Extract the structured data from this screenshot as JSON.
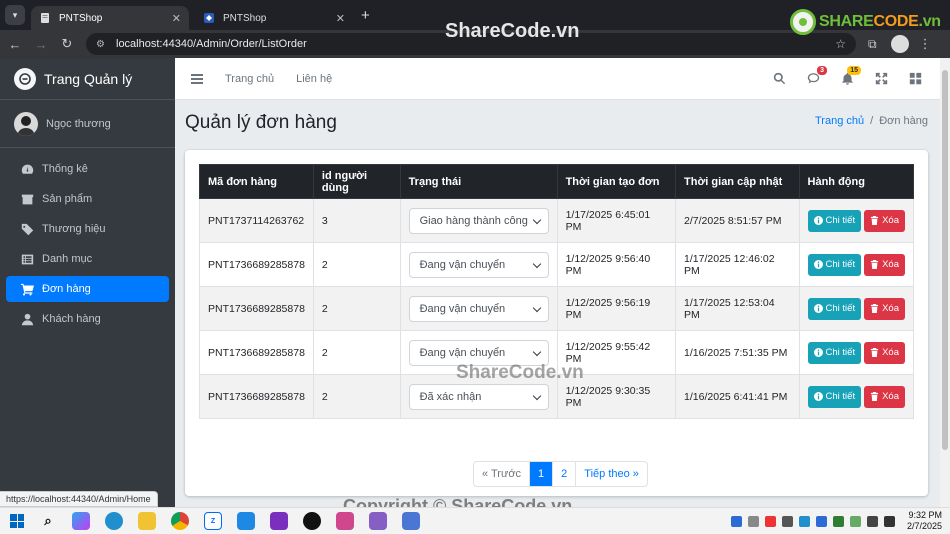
{
  "browser": {
    "tabs": [
      {
        "title": "PNTShop",
        "active": true,
        "close": "✕"
      },
      {
        "title": "PNTShop",
        "active": false,
        "close": "✕"
      }
    ],
    "new_tab": "+",
    "url": "localhost:44340/Admin/Order/ListOrder",
    "status_url": "https://localhost:44340/Admin/Home"
  },
  "brand_logo": {
    "text_a": "SHARE",
    "text_b": "CODE",
    "text_c": ".vn"
  },
  "watermark": "ShareCode.vn",
  "copyright": "Copyright © ShareCode.vn",
  "sidebar": {
    "brand": "Trang Quản lý",
    "user": "Ngọc thương",
    "items": [
      {
        "label": "Thống kê",
        "icon": "gauge-icon",
        "active": false
      },
      {
        "label": "Sản phẩm",
        "icon": "box-icon",
        "active": false
      },
      {
        "label": "Thương hiệu",
        "icon": "tags-icon",
        "active": false
      },
      {
        "label": "Danh mục",
        "icon": "list-icon",
        "active": false
      },
      {
        "label": "Đơn hàng",
        "icon": "cart-icon",
        "active": true
      },
      {
        "label": "Khách hàng",
        "icon": "user-icon",
        "active": false
      }
    ]
  },
  "topnav": {
    "links": [
      "Trang chủ",
      "Liên hệ"
    ],
    "messages_badge": "3",
    "notifications_badge": "15"
  },
  "page": {
    "title": "Quản lý đơn hàng",
    "breadcrumb": {
      "home": "Trang chủ",
      "sep": "/",
      "current": "Đơn hàng"
    }
  },
  "table": {
    "headers": [
      "Mã đơn hàng",
      "id người dùng",
      "Trạng thái",
      "Thời gian tạo đơn",
      "Thời gian cập nhật",
      "Hành động"
    ],
    "rows": [
      {
        "code": "PNT1737114263762",
        "user_id": "3",
        "status": "Giao hàng thành công",
        "created": "1/17/2025 6:45:01 PM",
        "updated": "2/7/2025 8:51:57 PM"
      },
      {
        "code": "PNT1736689285878",
        "user_id": "2",
        "status": "Đang vận chuyển",
        "created": "1/12/2025 9:56:40 PM",
        "updated": "1/17/2025 12:46:02 PM"
      },
      {
        "code": "PNT1736689285878",
        "user_id": "2",
        "status": "Đang vận chuyển",
        "created": "1/12/2025 9:56:19 PM",
        "updated": "1/17/2025 12:53:04 PM"
      },
      {
        "code": "PNT1736689285878",
        "user_id": "2",
        "status": "Đang vận chuyển",
        "created": "1/12/2025 9:55:42 PM",
        "updated": "1/16/2025 7:51:35 PM"
      },
      {
        "code": "PNT1736689285878",
        "user_id": "2",
        "status": "Đã xác nhận",
        "created": "1/12/2025 9:30:35 PM",
        "updated": "1/16/2025 6:41:41 PM"
      }
    ],
    "detail_label": "Chi tiết",
    "delete_label": "Xóa"
  },
  "pagination": {
    "prev": "« Trước",
    "pages": [
      "1",
      "2"
    ],
    "current": "1",
    "next": "Tiếp theo »"
  },
  "taskbar": {
    "time": "9:32 PM",
    "date": "2/7/2025"
  },
  "colors": {
    "primary": "#007bff",
    "sidebar": "#343a40",
    "info": "#17a2b8",
    "danger": "#dc3545",
    "table_head": "#212529"
  }
}
